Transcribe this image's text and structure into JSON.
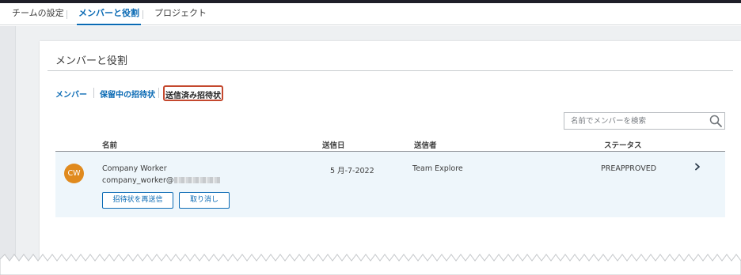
{
  "tabs": [
    {
      "label": "チームの設定",
      "active": false
    },
    {
      "label": "メンバーと役割",
      "active": true
    },
    {
      "label": "プロジェクト",
      "active": false
    }
  ],
  "page": {
    "title": "メンバーと役割"
  },
  "subtabs": {
    "members": "メンバー",
    "pending": "保留中の招待状",
    "sent": "送信済み招待状"
  },
  "search": {
    "placeholder": "名前でメンバーを検索",
    "icon": "search-icon"
  },
  "table": {
    "headers": {
      "name": "名前",
      "sent_date": "送信日",
      "sender": "送信者",
      "status": "ステータス"
    },
    "rows": [
      {
        "initials": "CW",
        "avatar_color": "#e08a1e",
        "name": "Company Worker",
        "email": "company_worker@",
        "sent_date": "5 月-7-2022",
        "sender": "Team Explore",
        "status": "PREAPPROVED",
        "resend_label": "招待状を再送信",
        "cancel_label": "取り消し"
      }
    ]
  },
  "colors": {
    "accent": "#0a6ab4",
    "highlight": "#c4482e",
    "row_bg": "#eef6fb"
  }
}
